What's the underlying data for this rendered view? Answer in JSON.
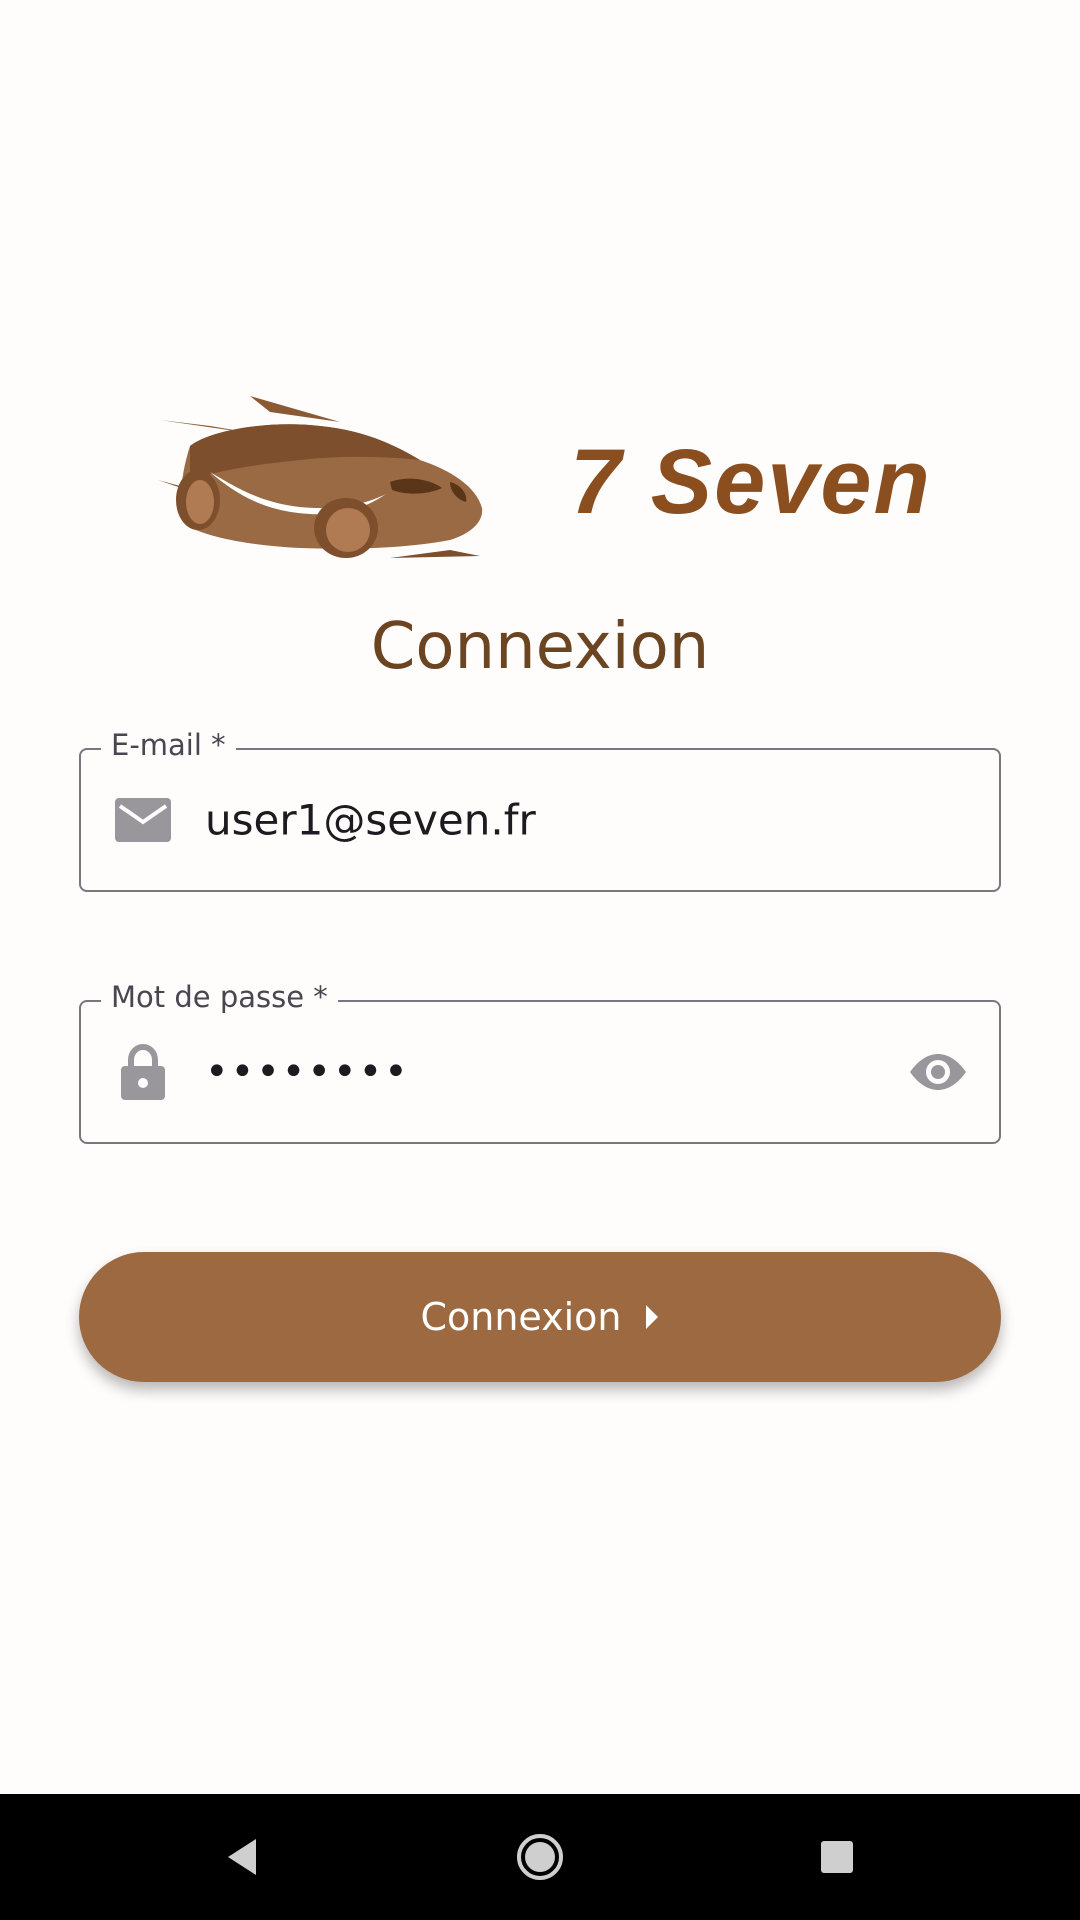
{
  "logo": {
    "text": "7 Seven",
    "color": "#8a4e1f"
  },
  "title": "Connexion",
  "form": {
    "email": {
      "label": "E-mail *",
      "value": "user1@seven.fr",
      "icon": "mail-icon"
    },
    "password": {
      "label": "Mot de passe *",
      "value": "••••••••",
      "icon": "lock-icon",
      "toggle_icon": "eye-icon"
    },
    "submit": {
      "label": "Connexion",
      "icon": "chevron-right-icon",
      "color": "#9c6941"
    }
  },
  "navbar": {
    "back_icon": "back-triangle-icon",
    "home_icon": "home-circle-icon",
    "recent_icon": "recent-square-icon"
  },
  "colors": {
    "background": "#fffcfc",
    "title": "#6b4422",
    "outline": "#7a7680"
  }
}
